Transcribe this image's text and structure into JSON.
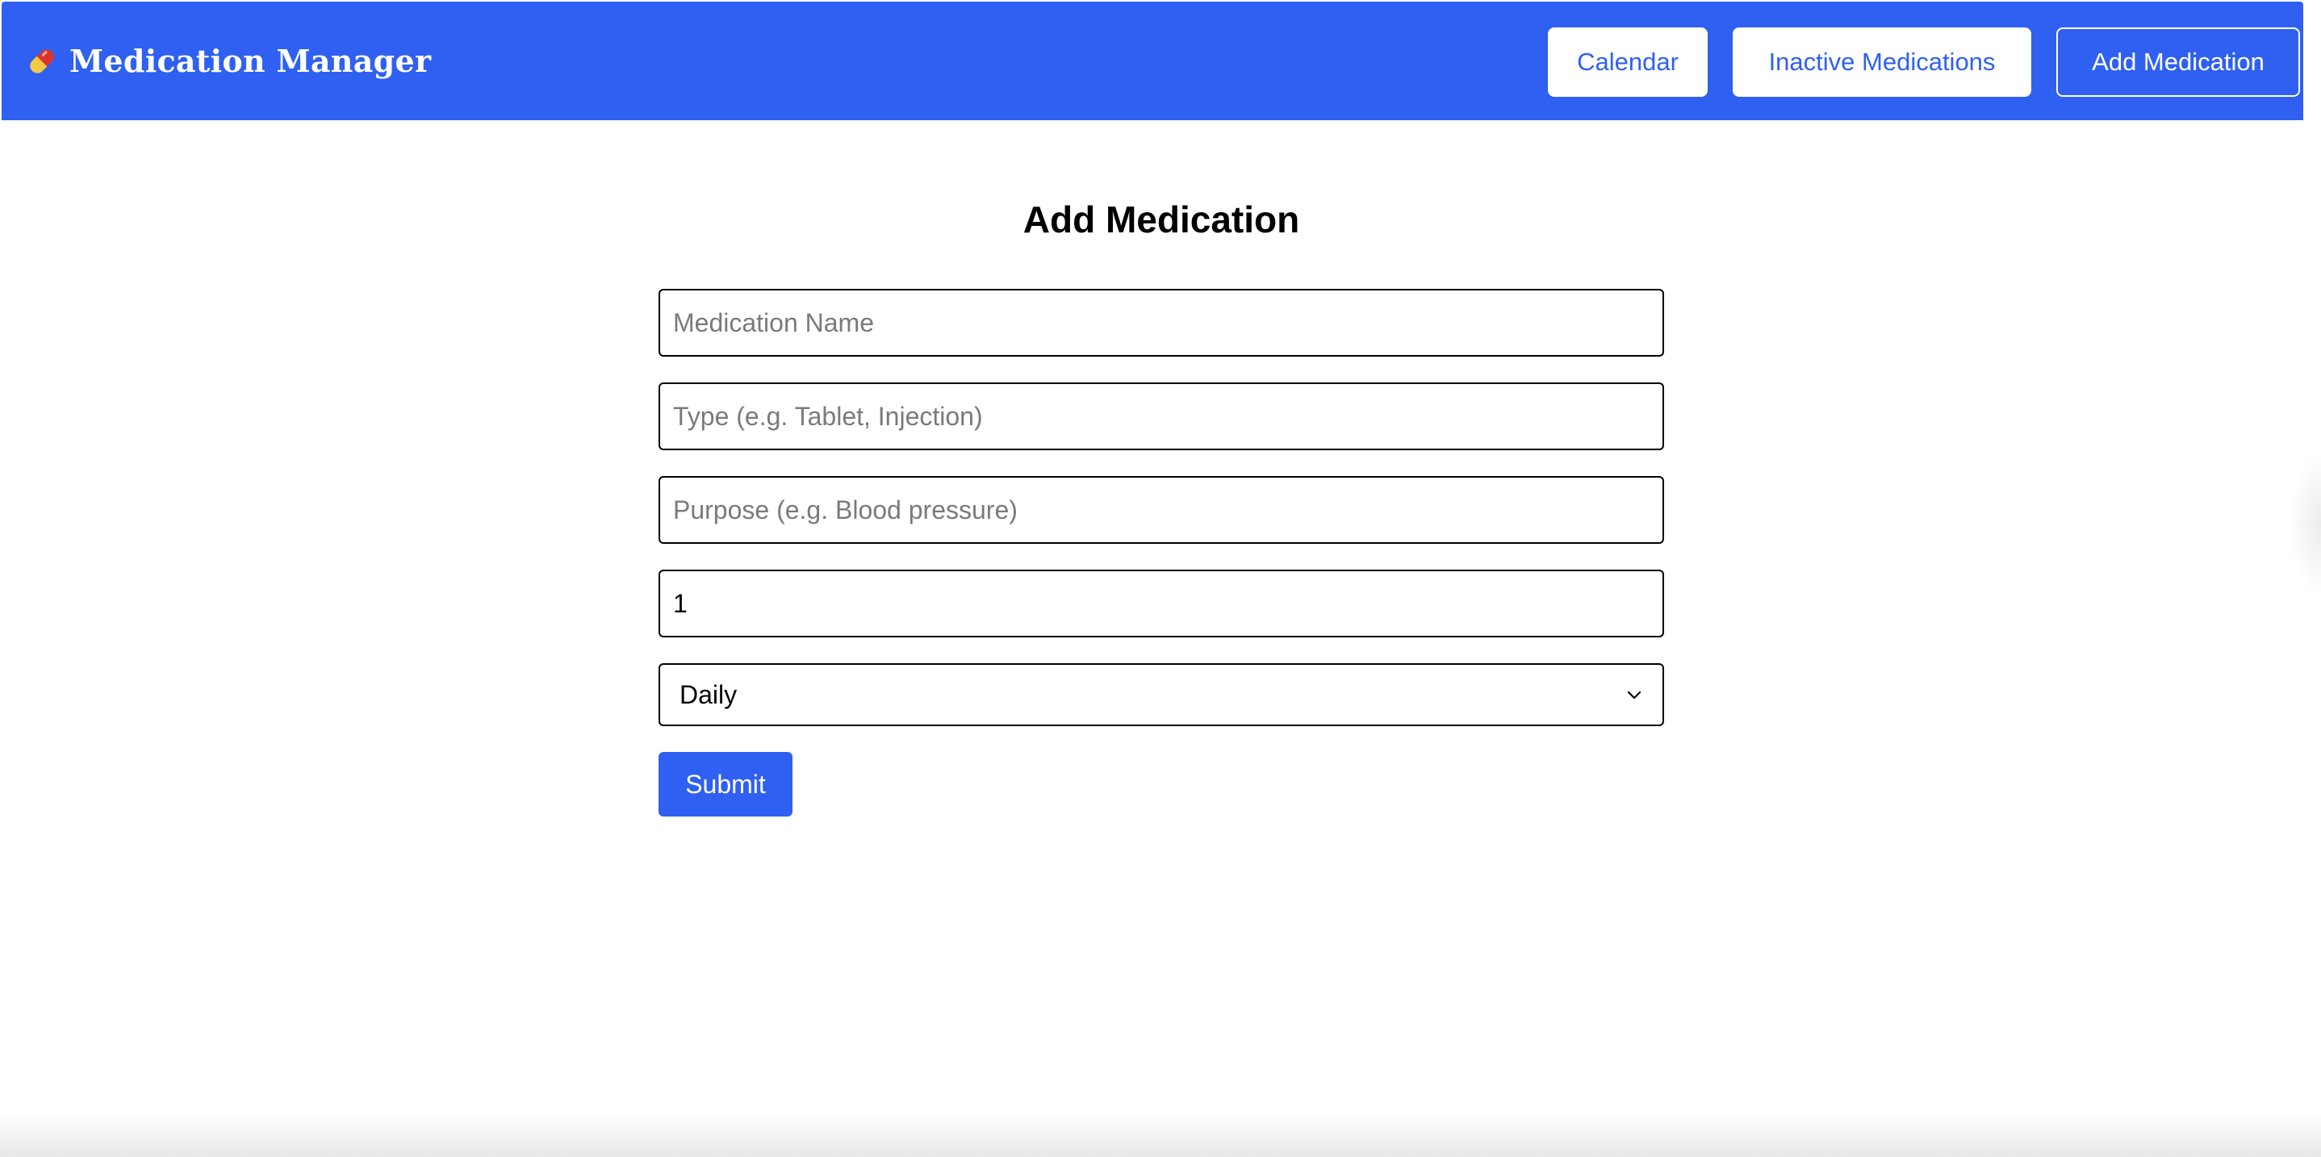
{
  "header": {
    "app_icon": "pill-icon",
    "title": "Medication Manager",
    "nav": {
      "calendar_label": "Calendar",
      "inactive_label": "Inactive Medications",
      "add_label": "Add Medication"
    },
    "background_color": "#2f60f2"
  },
  "form": {
    "title": "Add Medication",
    "name": {
      "placeholder": "Medication Name",
      "value": ""
    },
    "type": {
      "placeholder": "Type (e.g. Tablet, Injection)",
      "value": ""
    },
    "purpose": {
      "placeholder": "Purpose (e.g. Blood pressure)",
      "value": ""
    },
    "dose": {
      "value": "1"
    },
    "frequency": {
      "selected": "Daily"
    },
    "submit_label": "Submit"
  },
  "colors": {
    "accent": "#2f60f2",
    "text": "#000000",
    "placeholder": "#7a7a7a"
  }
}
